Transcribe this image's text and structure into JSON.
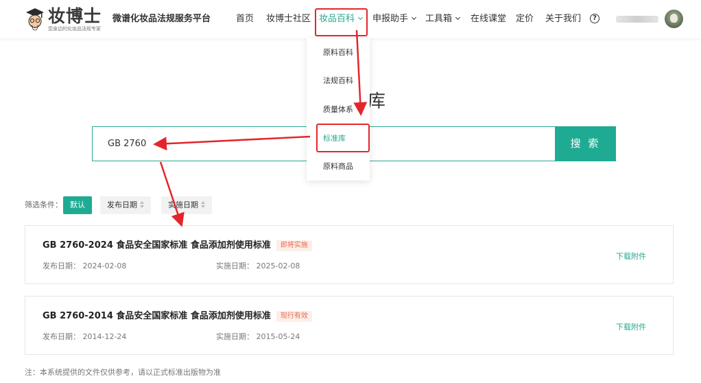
{
  "brand": {
    "name": "妆博士",
    "tagline": "您身边的化妆品法规专家",
    "platform": "微谱化妆品法规服务平台"
  },
  "nav": {
    "items": [
      {
        "label": "首页"
      },
      {
        "label": "妆博士社区"
      },
      {
        "label": "妆品百科"
      },
      {
        "label": "申报助手"
      },
      {
        "label": "工具箱"
      },
      {
        "label": "在线课堂"
      },
      {
        "label": "定价"
      },
      {
        "label": "关于我们"
      }
    ],
    "help": "?"
  },
  "dropdown": {
    "items": [
      {
        "label": "原料百科"
      },
      {
        "label": "法规百科"
      },
      {
        "label": "质量体系"
      },
      {
        "label": "标准库"
      },
      {
        "label": "原料商品"
      }
    ]
  },
  "page": {
    "title_visible": "库"
  },
  "search": {
    "value": "GB 2760",
    "button": "搜 索"
  },
  "filters": {
    "label": "筛选条件：",
    "default": "默认",
    "publish_date": "发布日期",
    "effective_date": "实施日期"
  },
  "results": [
    {
      "title": "GB 2760-2024 食品安全国家标准 食品添加剂使用标准",
      "badge": "即将实施",
      "publish": "发布日期：  2024-02-08",
      "effective": "实施日期：  2025-02-08",
      "download": "下载附件"
    },
    {
      "title": "GB 2760-2014 食品安全国家标准 食品添加剂使用标准",
      "badge": "现行有效",
      "publish": "发布日期：  2014-12-24",
      "effective": "实施日期：  2015-05-24",
      "download": "下载附件"
    }
  ],
  "note": "注：本系统提供的文件仅供参考，请以正式标准出版物为准",
  "colors": {
    "accent": "#1fab93",
    "annotation": "#e3262b",
    "badge_text": "#e86a50"
  }
}
